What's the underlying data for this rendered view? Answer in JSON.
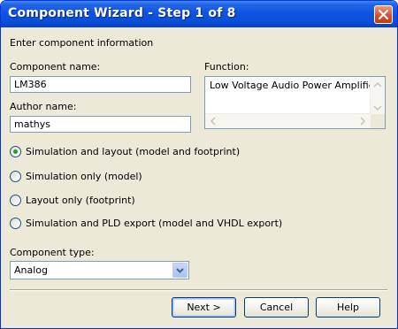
{
  "window": {
    "title": "Component Wizard - Step 1 of 8"
  },
  "instructions": "Enter component information",
  "component_name": {
    "label": "Component name:",
    "value": "LM386"
  },
  "author_name": {
    "label": "Author name:",
    "value": "mathys"
  },
  "function": {
    "label": "Function:",
    "value": "Low Voltage Audio Power Amplifier"
  },
  "options": [
    {
      "label": "Simulation and layout (model and footprint)",
      "selected": true
    },
    {
      "label": "Simulation only (model)",
      "selected": false
    },
    {
      "label": "Layout only (footprint)",
      "selected": false
    },
    {
      "label": "Simulation and PLD export (model and VHDL export)",
      "selected": false
    }
  ],
  "component_type": {
    "label": "Component type:",
    "value": "Analog"
  },
  "buttons": {
    "next": "Next >",
    "cancel": "Cancel",
    "help": "Help"
  },
  "colors": {
    "titlebar": "#0a4ed8",
    "dialog_bg": "#ece9d8",
    "close_button": "#d1542e",
    "radio_dot": "#21a121"
  }
}
